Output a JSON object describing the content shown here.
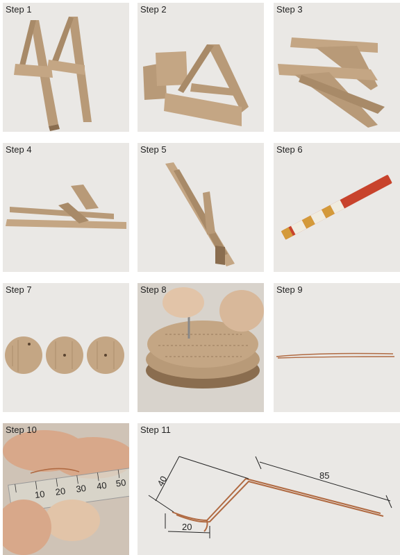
{
  "steps": [
    {
      "label": "Step 1"
    },
    {
      "label": "Step 2"
    },
    {
      "label": "Step 3"
    },
    {
      "label": "Step 4"
    },
    {
      "label": "Step 5"
    },
    {
      "label": "Step 6"
    },
    {
      "label": "Step 7"
    },
    {
      "label": "Step 8"
    },
    {
      "label": "Step 9"
    },
    {
      "label": "Step 10"
    },
    {
      "label": "Step 11"
    }
  ],
  "step10_ruler_ticks": [
    "10",
    "20",
    "30",
    "40",
    "50"
  ],
  "step11_dimensions": {
    "height": "40",
    "width": "20",
    "length": "85"
  },
  "colors": {
    "cardboard": "#b89a78",
    "cardboard_dark": "#8a6d4f",
    "copper": "#b06a42",
    "pencil_red": "#c8432c"
  }
}
